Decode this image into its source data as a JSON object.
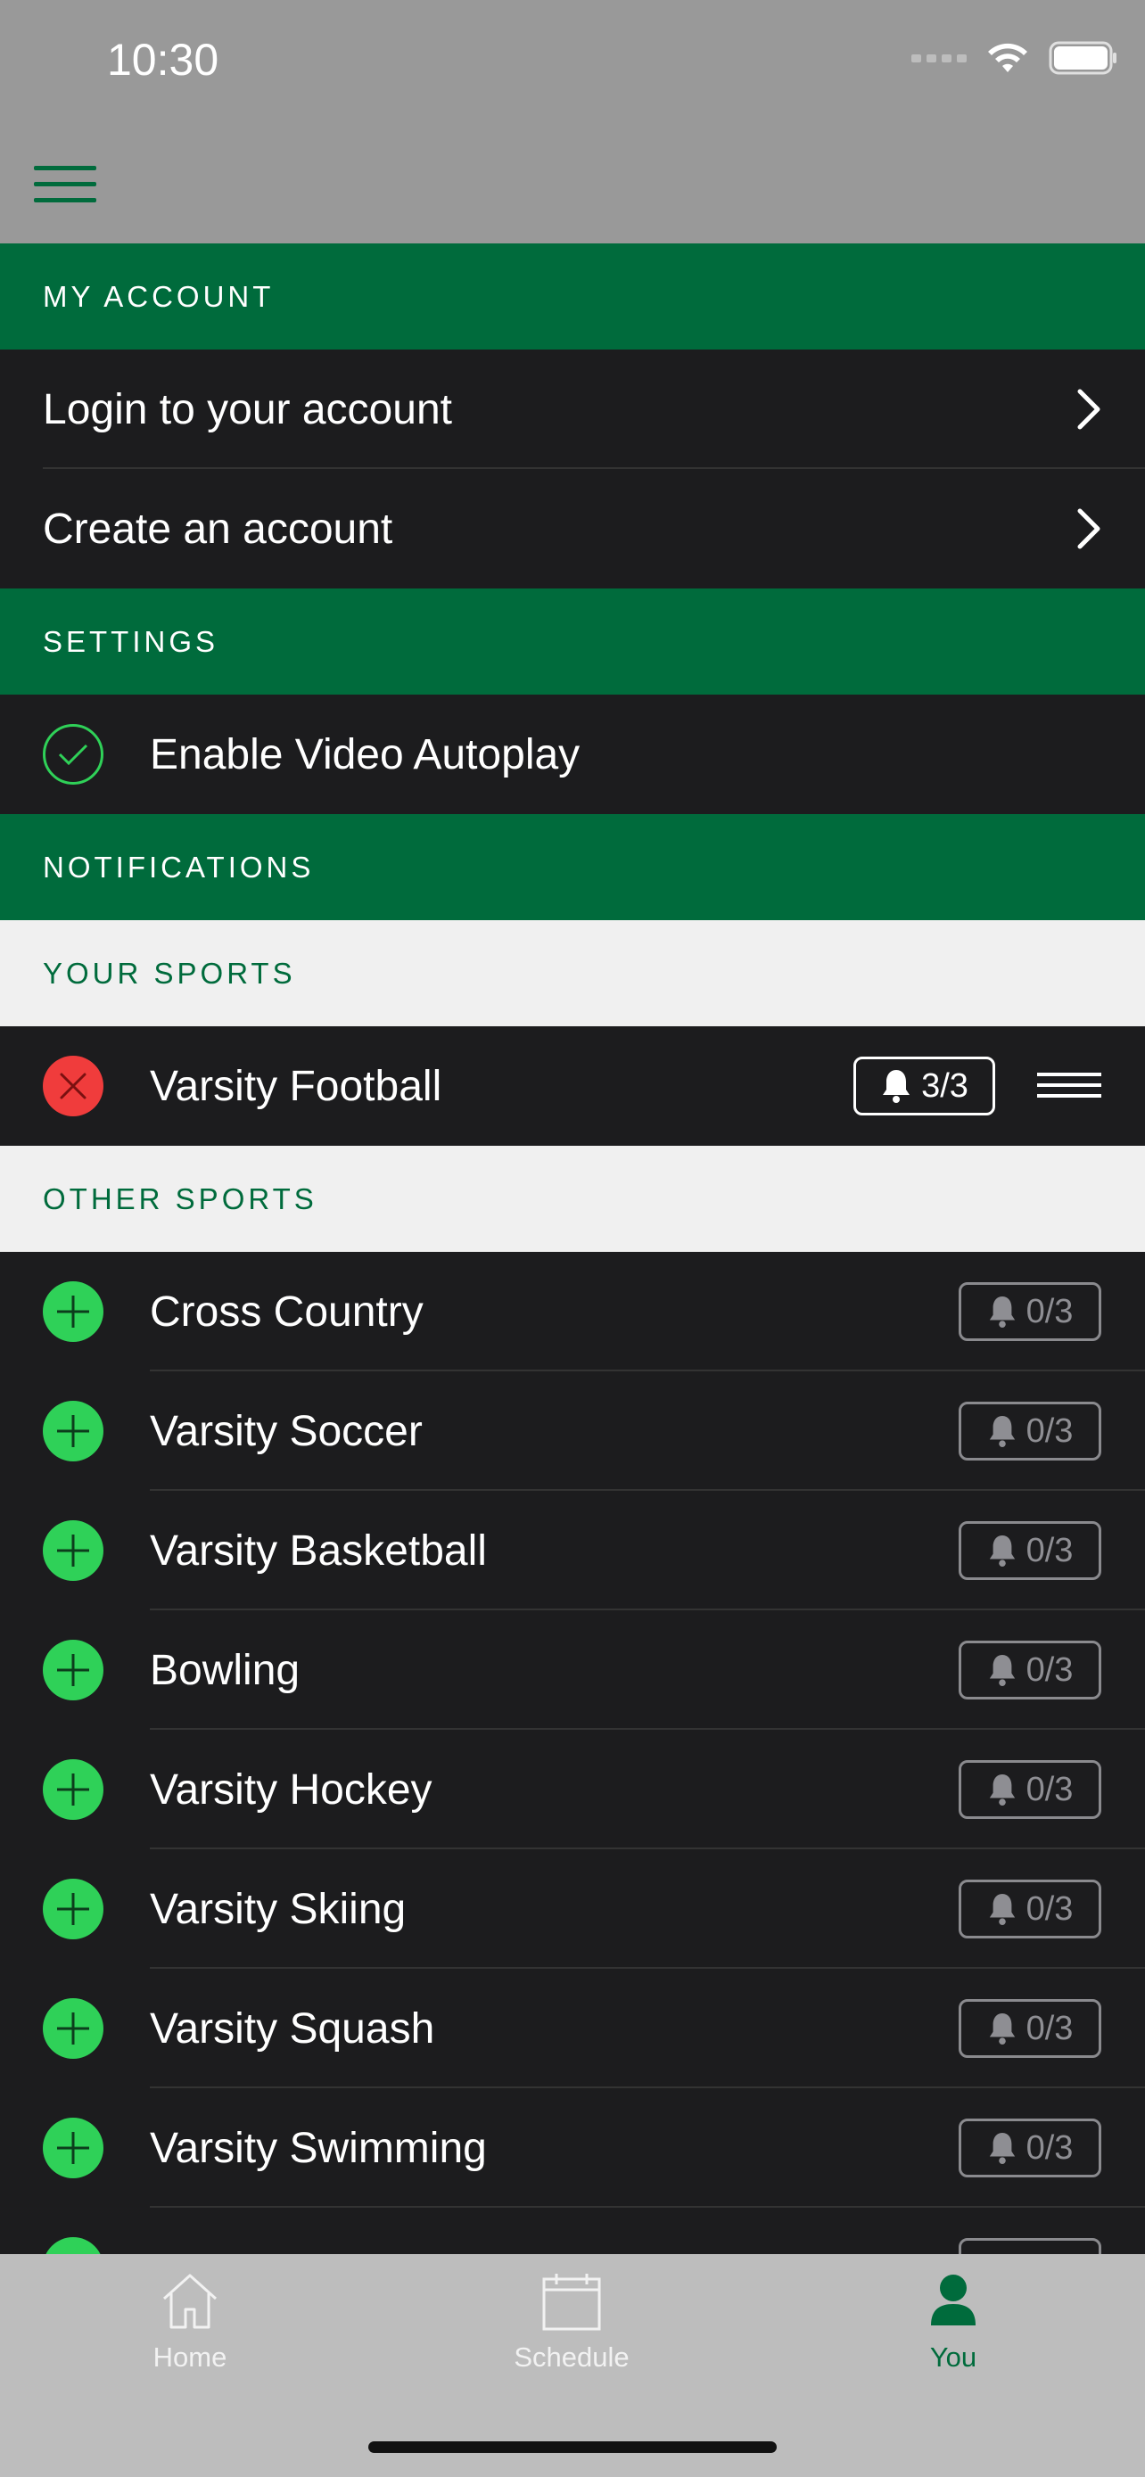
{
  "status_bar": {
    "time": "10:30"
  },
  "header": {
    "menu_icon": "hamburger-menu-icon"
  },
  "my_account": {
    "title": "MY ACCOUNT",
    "items": [
      {
        "label": "Login to your account"
      },
      {
        "label": "Create an account"
      }
    ]
  },
  "settings": {
    "title": "SETTINGS",
    "autoplay": {
      "label": "Enable Video Autoplay",
      "enabled": true
    }
  },
  "notifications": {
    "title": "NOTIFICATIONS"
  },
  "your_sports": {
    "title": "YOUR SPORTS",
    "items": [
      {
        "label": "Varsity Football",
        "count": "3/3"
      }
    ]
  },
  "other_sports": {
    "title": "OTHER SPORTS",
    "items": [
      {
        "label": "Cross Country",
        "count": "0/3"
      },
      {
        "label": "Varsity Soccer",
        "count": "0/3"
      },
      {
        "label": "Varsity Basketball",
        "count": "0/3"
      },
      {
        "label": "Bowling",
        "count": "0/3"
      },
      {
        "label": "Varsity Hockey",
        "count": "0/3"
      },
      {
        "label": "Varsity Skiing",
        "count": "0/3"
      },
      {
        "label": "Varsity Squash",
        "count": "0/3"
      },
      {
        "label": "Varsity Swimming",
        "count": "0/3"
      }
    ]
  },
  "tabbar": {
    "tabs": [
      {
        "label": "Home",
        "icon": "home-icon"
      },
      {
        "label": "Schedule",
        "icon": "calendar-icon"
      },
      {
        "label": "You",
        "icon": "person-icon",
        "active": true
      }
    ]
  },
  "colors": {
    "accent": "#006b3c",
    "add": "#2fd158",
    "remove": "#f03c3c",
    "row_bg": "#1c1c1e"
  }
}
